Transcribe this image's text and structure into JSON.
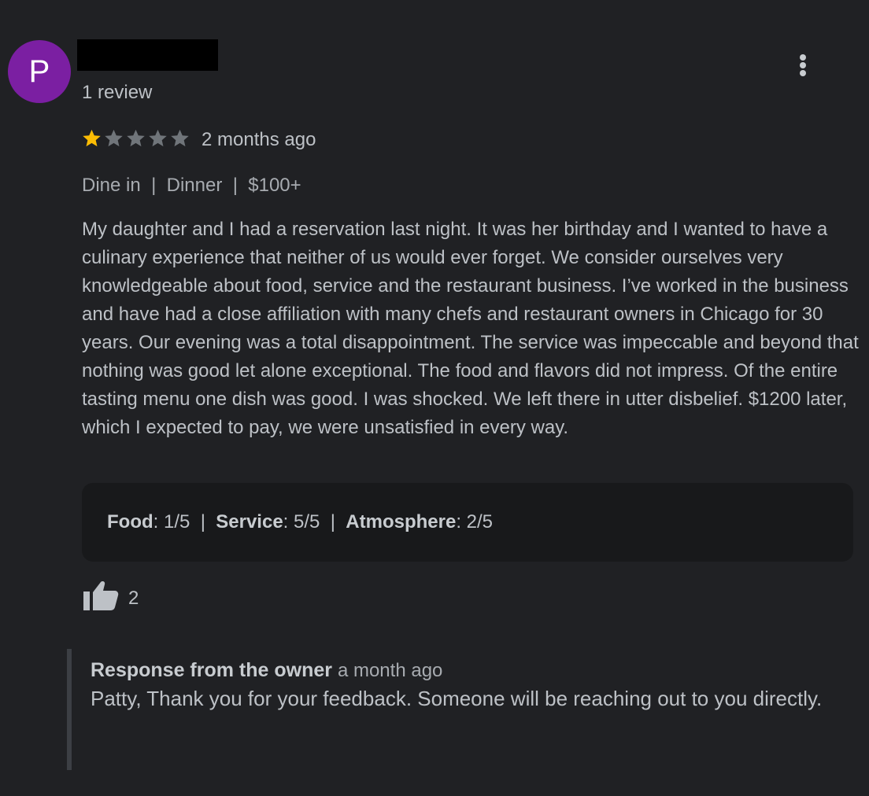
{
  "reviewer": {
    "avatar_initial": "P",
    "avatar_color": "#7b1fa2",
    "review_count": "1 review"
  },
  "menu": {
    "icon": "more-vert-icon"
  },
  "review": {
    "rating": 1,
    "max_rating": 5,
    "time": "2 months ago",
    "tags": {
      "dine": "Dine in",
      "meal": "Dinner",
      "price": "$100+",
      "separator": "|"
    },
    "text": "My daughter and I had a reservation last night. It was her birthday and I wanted to have a culinary experience that neither of us would ever forget. We consider ourselves very knowledgeable about food, service and the restaurant business. I’ve worked in the business and have had a close affiliation with many chefs and restaurant owners in Chicago for 30 years. Our evening was a total disappointment. The service was impeccable and beyond that nothing was good let alone exceptional. The food and flavors did not impress. Of the entire tasting menu one dish was good. I was shocked. We left there in utter disbelief. $1200 later, which I expected to pay, we were unsatisfied in every way.",
    "sub_ratings": {
      "food_label": "Food",
      "food_value": ": 1/5",
      "service_label": "Service",
      "service_value": ": 5/5",
      "atmosphere_label": "Atmosphere",
      "atmosphere_value": ": 2/5",
      "separator": "|"
    },
    "likes": "2"
  },
  "owner_response": {
    "label": "Response from the owner",
    "time": "a month ago",
    "text": "Patty, Thank you for your feedback. Someone will be reaching out to you directly."
  },
  "colors": {
    "background": "#202124",
    "star_filled": "#fbbc04",
    "star_empty": "#70757a"
  }
}
